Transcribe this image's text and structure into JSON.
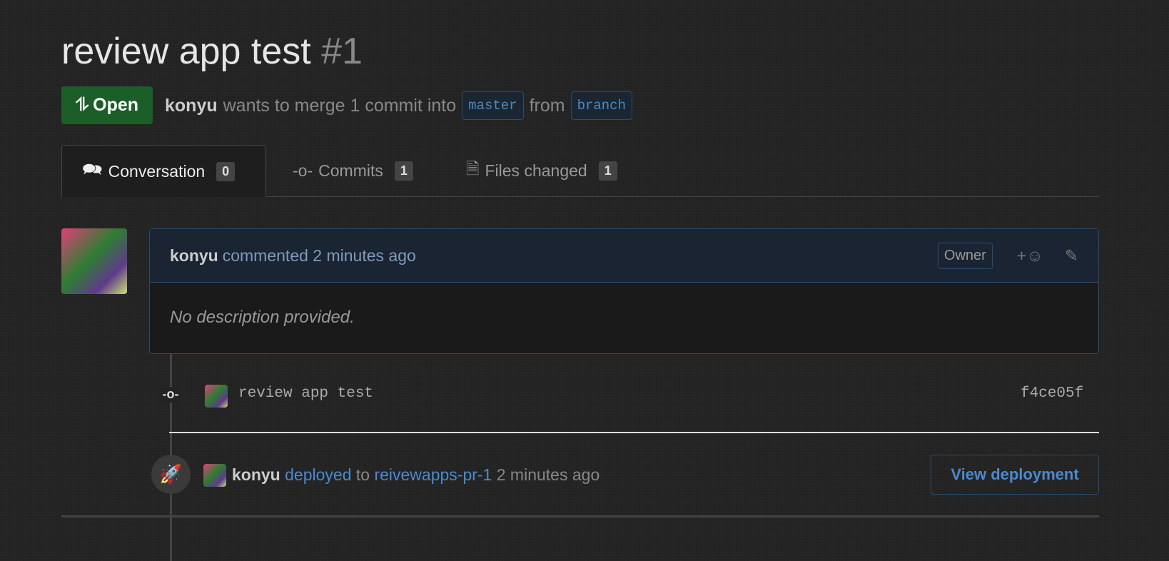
{
  "pr": {
    "title": "review app test",
    "number": "#1",
    "state": "Open",
    "author": "konyu",
    "merge_text": "wants to merge 1 commit into",
    "base": "master",
    "from": "from",
    "head": "branch"
  },
  "tabs": [
    {
      "label": "Conversation",
      "count": "0"
    },
    {
      "label": "Commits",
      "count": "1"
    },
    {
      "label": "Files changed",
      "count": "1"
    }
  ],
  "comment": {
    "author": "konyu",
    "action": "commented 2 minutes ago",
    "badge": "Owner",
    "reaction": "+",
    "body": "No description provided."
  },
  "commit": {
    "message": "review app test",
    "sha": "f4ce05f"
  },
  "deploy": {
    "author": "konyu",
    "action": "deployed",
    "to": "to",
    "env": "reivewapps-pr-1",
    "time": "2 minutes ago",
    "button": "View deployment"
  }
}
